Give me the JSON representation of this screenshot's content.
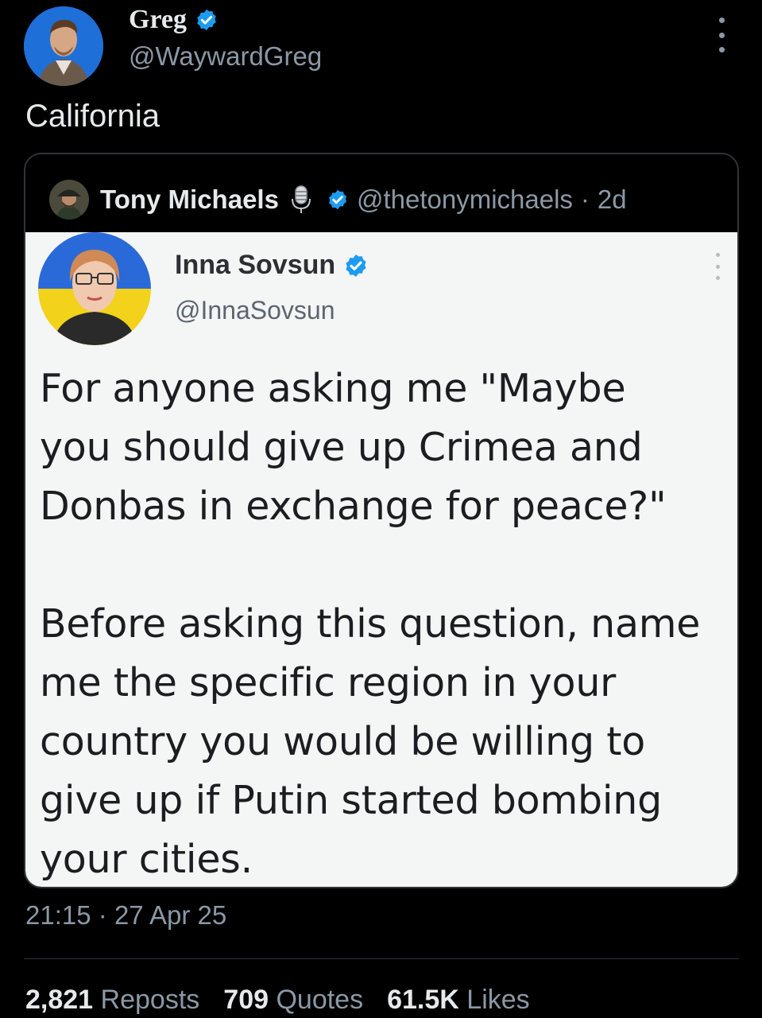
{
  "tweet": {
    "author_name": "Greg",
    "author_handle": "@WaywardGreg",
    "text": "California",
    "timestamp_time": "21:15",
    "timestamp_sep": "·",
    "timestamp_date": "27 Apr 25"
  },
  "quoted": {
    "author_name": "Tony Michaels",
    "author_handle": "@thetonymichaels",
    "sep": "·",
    "age": "2d"
  },
  "embedded": {
    "author_name": "Inna Sovsun",
    "author_handle": "@InnaSovsun",
    "lines_1": [
      "For anyone asking me \"Maybe",
      "you should give up Crimea and",
      "Donbas in exchange for peace?\""
    ],
    "lines_2": [
      "Before asking this question, name",
      "me the specific region in your",
      "country you would be willing to",
      "give up if Putin started bombing",
      "your cities."
    ]
  },
  "stats": {
    "reposts_count": "2,821",
    "reposts_label": "Reposts",
    "quotes_count": "709",
    "quotes_label": "Quotes",
    "likes_count": "61.5K",
    "likes_label": "Likes"
  },
  "colors": {
    "background": "#000000",
    "text": "#e7e9ea",
    "muted": "#8b98a5",
    "verified": "#1d9bf0",
    "card_border": "#2f3336",
    "embedded_bg": "#f4f5f5"
  },
  "icons": [
    "verified-badge-icon",
    "more-options-icon",
    "microphone-icon"
  ]
}
